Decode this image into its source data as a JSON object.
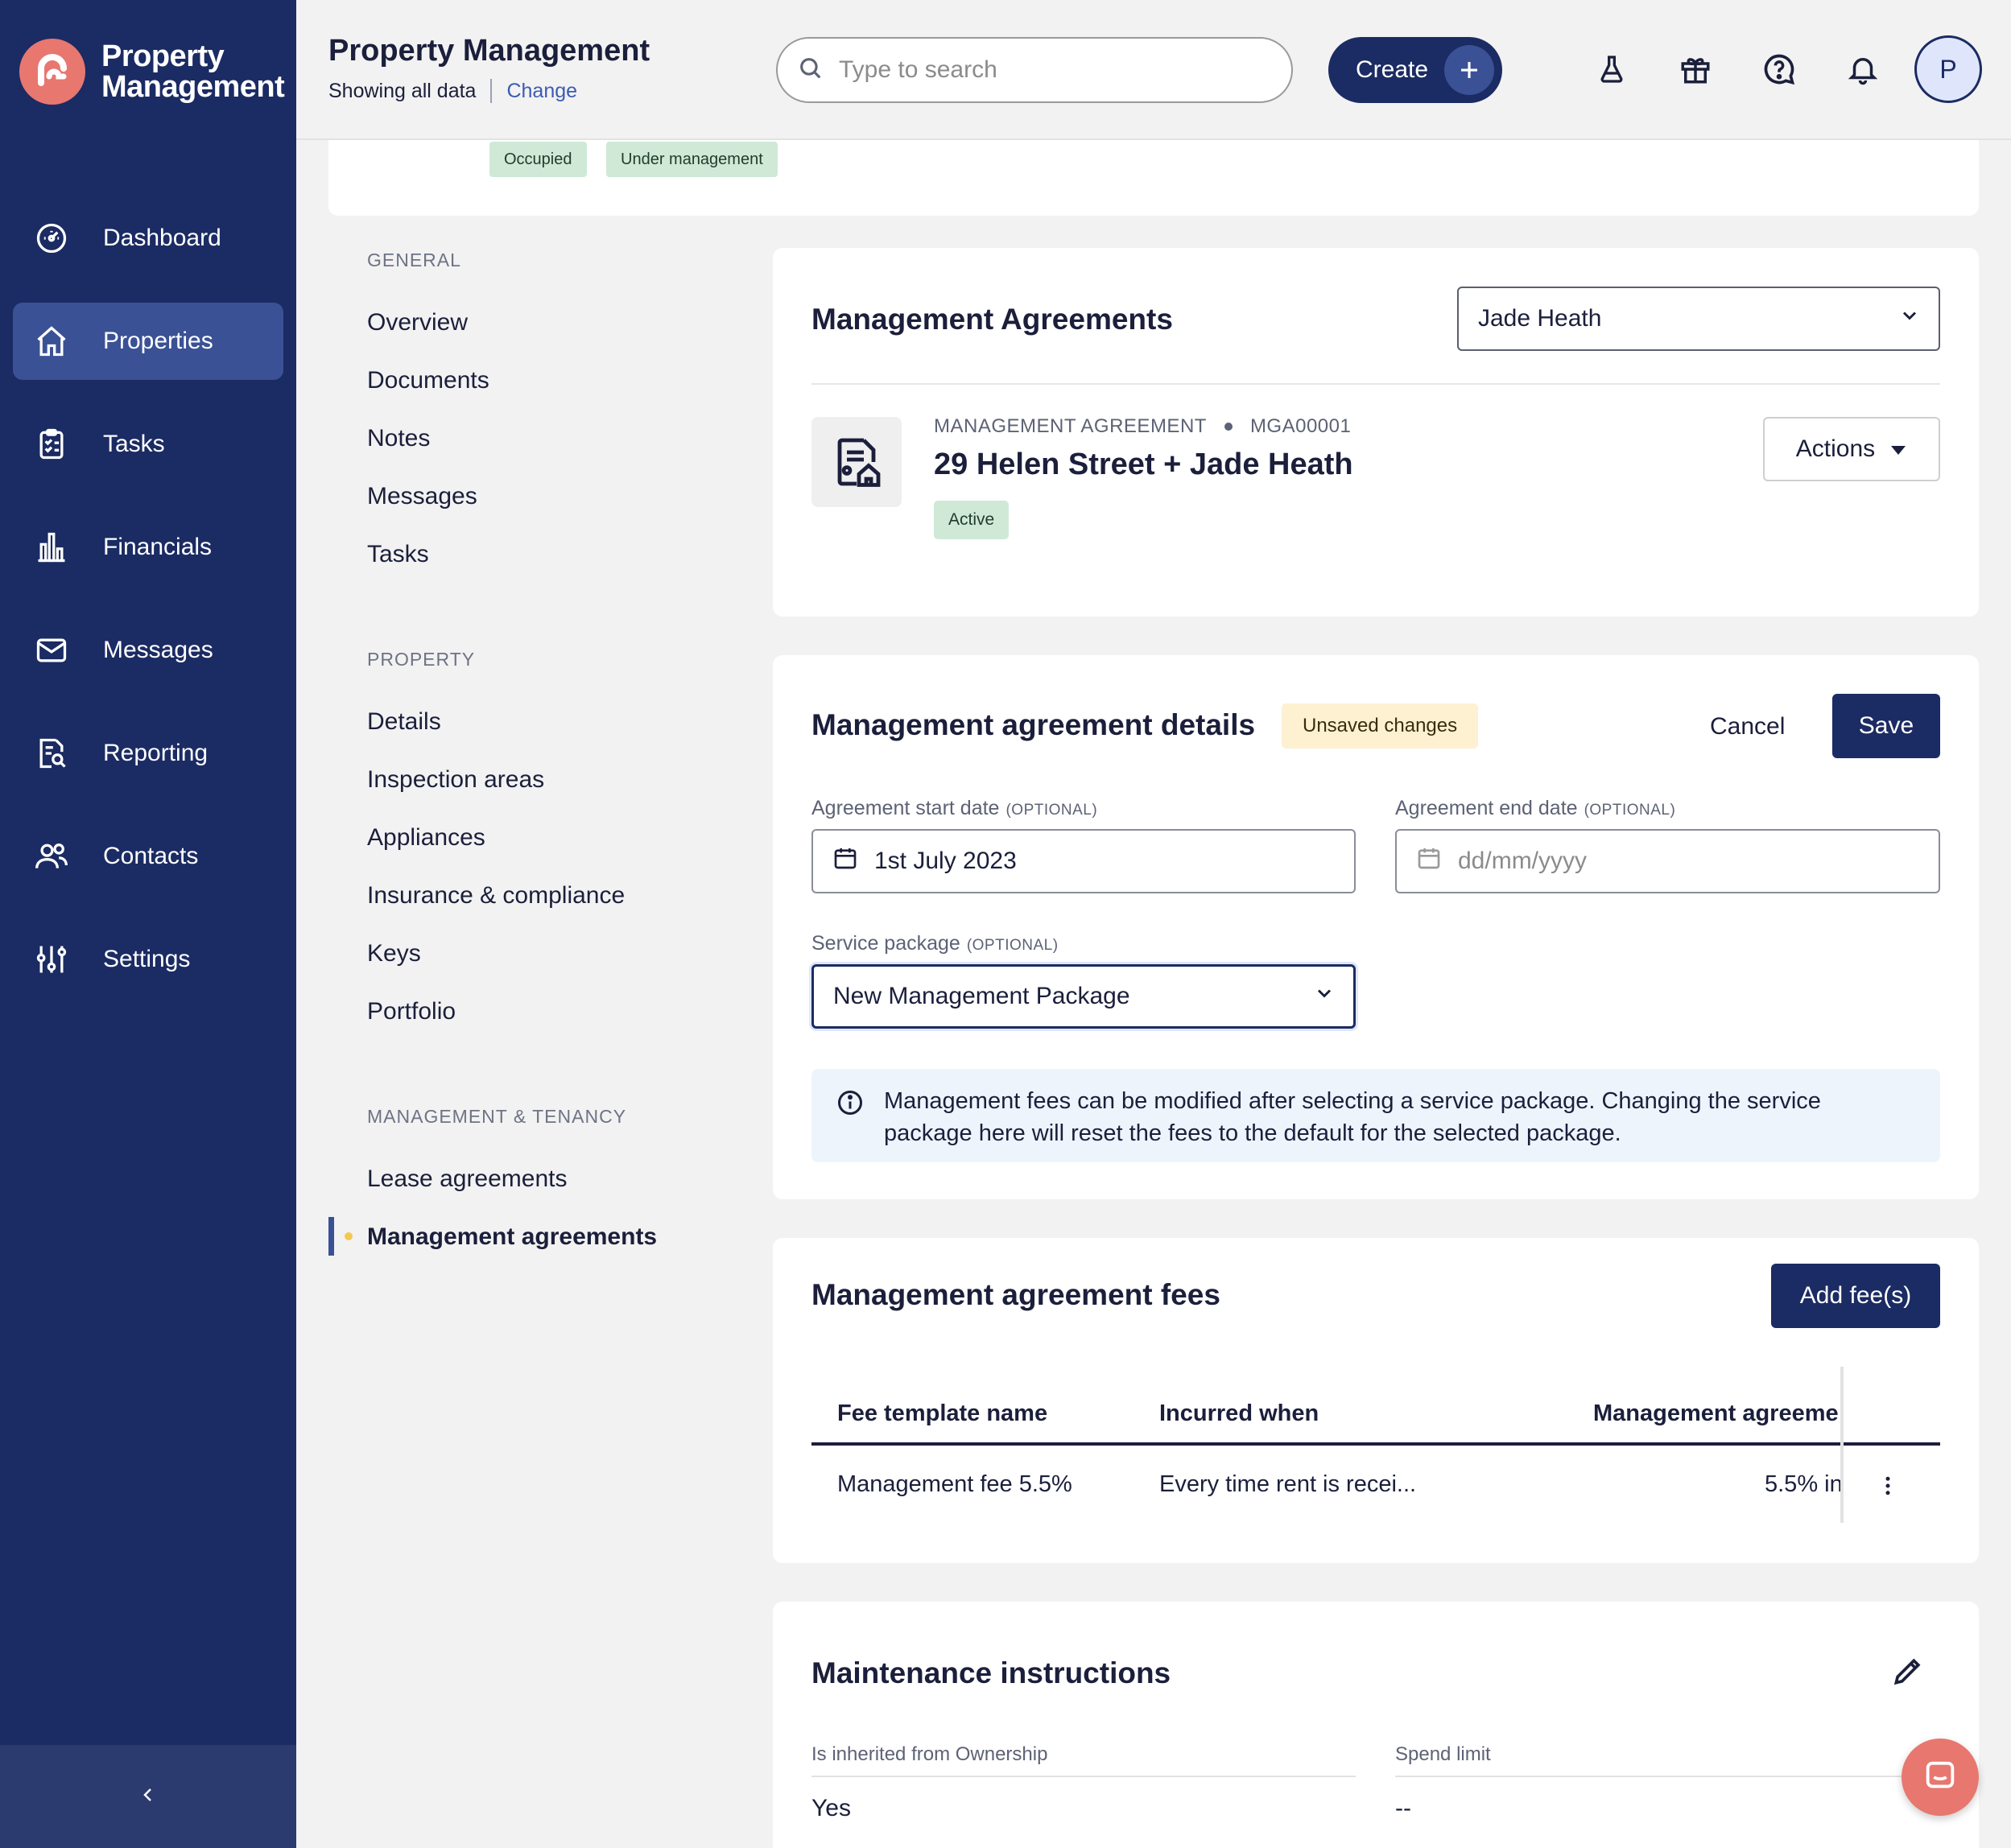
{
  "brand": {
    "name_line1": "Property",
    "name_line2": "Management",
    "accent": "#e8776f",
    "nav_bg": "#1b2b63"
  },
  "sidebar": {
    "items": [
      {
        "label": "Dashboard",
        "icon": "dashboard-icon"
      },
      {
        "label": "Properties",
        "icon": "home-icon",
        "active": true
      },
      {
        "label": "Tasks",
        "icon": "clipboard-icon"
      },
      {
        "label": "Financials",
        "icon": "bar-chart-icon"
      },
      {
        "label": "Messages",
        "icon": "mail-icon"
      },
      {
        "label": "Reporting",
        "icon": "report-icon"
      },
      {
        "label": "Contacts",
        "icon": "contacts-icon"
      },
      {
        "label": "Settings",
        "icon": "sliders-icon"
      }
    ],
    "collapse_icon": "chevron-left-icon"
  },
  "header": {
    "title": "Property Management",
    "showing": "Showing all data",
    "change": "Change",
    "search_placeholder": "Type to search",
    "create_label": "Create",
    "avatar_initial": "P",
    "icons": [
      "flask-icon",
      "gift-icon",
      "help-icon",
      "bell-icon"
    ]
  },
  "property_tags": [
    "Occupied",
    "Under management"
  ],
  "subnav": {
    "general_heading": "GENERAL",
    "general": [
      "Overview",
      "Documents",
      "Notes",
      "Messages",
      "Tasks"
    ],
    "property_heading": "PROPERTY",
    "property": [
      "Details",
      "Inspection areas",
      "Appliances",
      "Insurance & compliance",
      "Keys",
      "Portfolio"
    ],
    "mgmt_heading": "MANAGEMENT & TENANCY",
    "mgmt": [
      "Lease agreements",
      "Management agreements"
    ]
  },
  "agreements": {
    "title": "Management Agreements",
    "owner_selected": "Jade Heath",
    "type_label": "MANAGEMENT AGREEMENT",
    "code": "MGA00001",
    "name": "29 Helen Street + Jade Heath",
    "status": "Active",
    "actions_label": "Actions"
  },
  "details": {
    "title": "Management agreement details",
    "unsaved": "Unsaved changes",
    "cancel": "Cancel",
    "save": "Save",
    "start_label": "Agreement start date",
    "end_label": "Agreement end date",
    "optional": "(OPTIONAL)",
    "start_value": "1st July 2023",
    "end_placeholder": "dd/mm/yyyy",
    "package_label": "Service package",
    "package_value": "New Management Package",
    "info_line1": "Management fees can be modified after selecting a service package. Changing the service",
    "info_line2": "package here will reset the fees to the default for the selected package."
  },
  "fees": {
    "title": "Management agreement fees",
    "add_label": "Add fee(s)",
    "columns": [
      "Fee template name",
      "Incurred when",
      "Management agreeme"
    ],
    "rows": [
      {
        "name": "Management fee 5.5%",
        "when": "Every time rent is recei...",
        "amount": "5.5% in"
      }
    ]
  },
  "maintenance": {
    "title": "Maintenance instructions",
    "inherited_label": "Is inherited from Ownership",
    "inherited_value": "Yes",
    "spend_label": "Spend limit",
    "spend_value": "--"
  }
}
